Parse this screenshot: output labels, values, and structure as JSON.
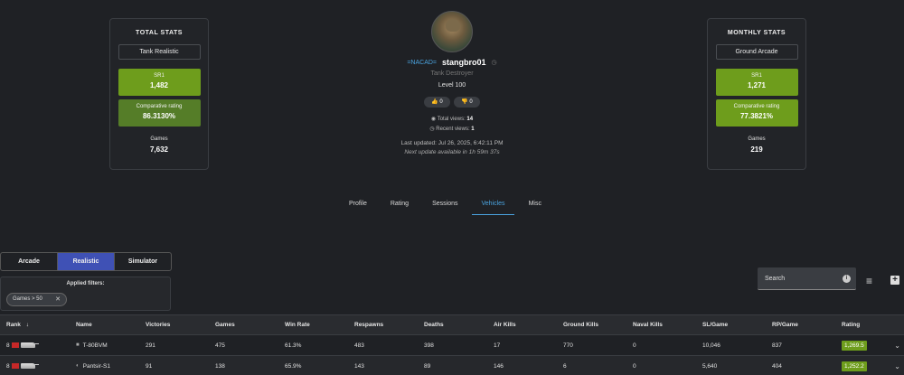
{
  "total_stats": {
    "title": "TOTAL STATS",
    "mode": "Tank Realistic",
    "sr1_label": "SR1",
    "sr1_value": "1,482",
    "comp_label": "Comparative rating",
    "comp_value": "86.3130%",
    "games_label": "Games",
    "games_value": "7,632"
  },
  "monthly_stats": {
    "title": "MONTHLY STATS",
    "mode": "Ground Arcade",
    "sr1_label": "SR1",
    "sr1_value": "1,271",
    "comp_label": "Comparative rating",
    "comp_value": "77.3821%",
    "games_label": "Games",
    "games_value": "219"
  },
  "profile": {
    "clan": "=NACAD=",
    "nickname": "stangbro01",
    "title": "Tank Destroyer",
    "level": "Level 100",
    "likes": "0",
    "dislikes": "0",
    "total_views_label": "Total views:",
    "total_views": "14",
    "recent_views_label": "Recent views:",
    "recent_views": "1",
    "last_updated": "Last updated: Jul 26, 2025, 6:42:11 PM",
    "next_update": "Next update available in 1h 59m 37s"
  },
  "tabs": [
    "Profile",
    "Rating",
    "Sessions",
    "Vehicles",
    "Misc"
  ],
  "active_tab": "Vehicles",
  "modes": [
    "Arcade",
    "Realistic",
    "Simulator"
  ],
  "active_mode": "Realistic",
  "filters": {
    "title": "Applied filters:",
    "chip": "Games > 50"
  },
  "search": {
    "label": "Search"
  },
  "table": {
    "headers": [
      "Rank",
      "Name",
      "Victories",
      "Games",
      "Win Rate",
      "Respawns",
      "Deaths",
      "Air Kills",
      "Ground Kills",
      "Naval Kills",
      "SL/Game",
      "RP/Game",
      "Rating"
    ],
    "rows": [
      {
        "rank": "8",
        "name": "T-80BVM",
        "victories": "291",
        "games": "475",
        "win_rate": "61.3%",
        "respawns": "483",
        "deaths": "398",
        "air_kills": "17",
        "ground_kills": "770",
        "naval_kills": "0",
        "sl_game": "10,046",
        "rp_game": "837",
        "rating": "1,269.5"
      },
      {
        "rank": "8",
        "name": "Pantsir-S1",
        "victories": "91",
        "games": "138",
        "win_rate": "65.9%",
        "respawns": "143",
        "deaths": "89",
        "air_kills": "146",
        "ground_kills": "6",
        "naval_kills": "0",
        "sl_game": "5,640",
        "rp_game": "404",
        "rating": "1,252.2"
      }
    ]
  }
}
